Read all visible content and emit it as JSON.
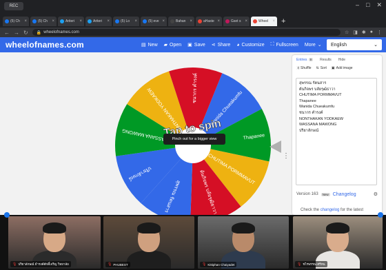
{
  "browser": {
    "profile_tab": "REC",
    "tabs": [
      {
        "title": "(5) Ch",
        "color": "#1877f2",
        "active": false
      },
      {
        "title": "(5) Ch",
        "color": "#1877f2",
        "active": false
      },
      {
        "title": "Ariteri",
        "color": "#1da1f2",
        "active": false
      },
      {
        "title": "Ariteri",
        "color": "#1da1f2",
        "active": false
      },
      {
        "title": "(5) Lo",
        "color": "#1877f2",
        "active": false
      },
      {
        "title": "(5) eve",
        "color": "#1877f2",
        "active": false
      },
      {
        "title": "Bahan",
        "color": "#444444",
        "active": false
      },
      {
        "title": "aHaste",
        "color": "#ea4335",
        "active": false
      },
      {
        "title": "Gset s",
        "color": "#c2185b",
        "active": false
      },
      {
        "title": "Wheel",
        "color": "#ea4335",
        "active": true
      }
    ],
    "url": "wheelofnames.com"
  },
  "site": {
    "logo": "wheelofnames.com",
    "menu": [
      {
        "label": "New",
        "icon": "file-icon"
      },
      {
        "label": "Open",
        "icon": "folder-icon"
      },
      {
        "label": "Save",
        "icon": "save-icon"
      },
      {
        "label": "Share",
        "icon": "share-icon"
      },
      {
        "label": "Customize",
        "icon": "palette-icon"
      },
      {
        "label": "Fullscreen",
        "icon": "fullscreen-icon"
      },
      {
        "label": "More",
        "icon": "chevron-down-icon"
      }
    ],
    "language": "English"
  },
  "wheel": {
    "spin_text": "Tap to spin",
    "tooltip": "Pinch out for a bigger view",
    "segments": [
      {
        "label": "Wanida Chueakumfu",
        "color": "#3369e8"
      },
      {
        "label": "Thapanee",
        "color": "#009925"
      },
      {
        "label": "CHUTIMA PORMMAVUT",
        "color": "#eeb211"
      },
      {
        "label": "ต้นกิจพร บลัยรุฒิธาวา",
        "color": "#d50f25"
      },
      {
        "label": "สุพรรณ รัตนสาร",
        "color": "#3369e8"
      },
      {
        "label": "ปริยาลักษณ์",
        "color": "#3369e8"
      },
      {
        "label": "WASSANA MAWONG",
        "color": "#009925"
      },
      {
        "label": "NONTHAKAN YODKAEW",
        "color": "#eeb211"
      },
      {
        "label": "ชนากร คำรงค์",
        "color": "#d50f25"
      }
    ]
  },
  "panel": {
    "tabs": [
      {
        "label": "Entries",
        "badge": "9"
      },
      {
        "label": "Results",
        "badge": ""
      },
      {
        "label": "Hide",
        "badge": ""
      }
    ],
    "tools": [
      "Shuffle",
      "Sort",
      "Add image"
    ],
    "entries": [
      "สุพรรณ รัตนสาร",
      "ต้นกิจพร บลัยรุฒิธาวา",
      "CHUTIMA PORMMAVUT",
      "Thapanee",
      "Wanida Chueakumfu",
      "ชนากร คำรงค์",
      "NONTHAKAN YODKAEW",
      "WASSANA MAWONG",
      "ปริยาลักษณ์"
    ],
    "version": "Version 163",
    "version_badge": "New",
    "changelog": "Changelog",
    "check_text_before": "Check the ",
    "check_link": "changelog",
    "check_text_after": " for the latest"
  },
  "video_call": {
    "participants": [
      {
        "name": "ปริยาลักษณ์ ธำรงค์ศักดิ์เจริญ วิทยาลัย",
        "muted": true,
        "bg": "#8d6e63",
        "shirt": "#2b2b2b",
        "skin": "#d7a987"
      },
      {
        "name": "PHUBEST",
        "muted": true,
        "bg": "#5d4a3a",
        "shirt": "#1e1e1e",
        "skin": "#cfa07f"
      },
      {
        "name": "Kittiphan Chaiyadet",
        "muted": true,
        "bg": "#6b6b6b",
        "shirt": "#2e3b4e",
        "skin": "#b98a6a"
      },
      {
        "name": "ชไรพรรณ ศรีหน",
        "muted": true,
        "bg": "#9c8e7e",
        "shirt": "#e8e6e3",
        "skin": "#d9ac8c"
      }
    ]
  }
}
